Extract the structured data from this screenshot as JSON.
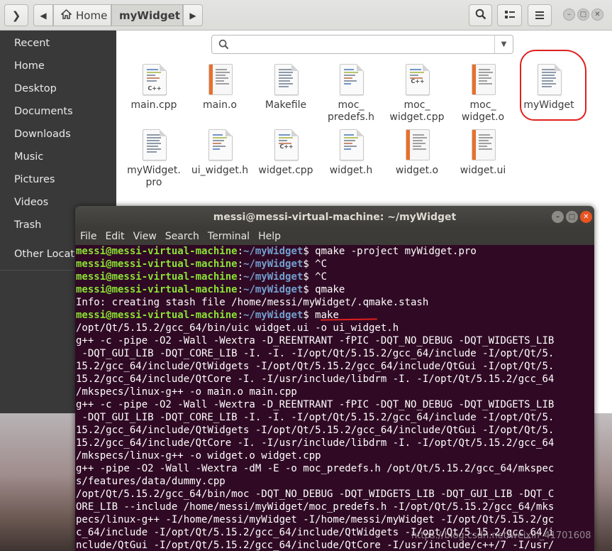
{
  "files_window": {
    "path": {
      "home_label": "Home",
      "current_label": "myWidget"
    },
    "sidebar": [
      {
        "label": "Recent"
      },
      {
        "label": "Home"
      },
      {
        "label": "Desktop"
      },
      {
        "label": "Documents"
      },
      {
        "label": "Downloads"
      },
      {
        "label": "Music"
      },
      {
        "label": "Pictures"
      },
      {
        "label": "Videos"
      },
      {
        "label": "Trash"
      },
      {
        "label": "Other Locations"
      }
    ],
    "search": {
      "placeholder": ""
    },
    "files": [
      {
        "name": "main.cpp",
        "icon": "cpp-file-icon"
      },
      {
        "name": "main.o",
        "icon": "object-file-icon"
      },
      {
        "name": "Makefile",
        "icon": "text-file-icon"
      },
      {
        "name": "moc_ predefs.h",
        "icon": "header-file-icon"
      },
      {
        "name": "moc_ widget.cpp",
        "icon": "cpp-file-icon"
      },
      {
        "name": "moc_ widget.o",
        "icon": "object-file-icon"
      },
      {
        "name": "myWidget",
        "icon": "executable-file-icon"
      },
      {
        "name": "myWidget. pro",
        "icon": "text-file-icon"
      },
      {
        "name": "ui_widget.h",
        "icon": "header-file-icon"
      },
      {
        "name": "widget.cpp",
        "icon": "cpp-file-icon"
      },
      {
        "name": "widget.h",
        "icon": "header-file-icon"
      },
      {
        "name": "widget.o",
        "icon": "object-file-icon"
      },
      {
        "name": "widget.ui",
        "icon": "object-file-icon"
      }
    ],
    "annotation_color": "#e0201e"
  },
  "terminal": {
    "title": "messi@messi-virtual-machine: ~/myWidget",
    "menu": [
      "File",
      "Edit",
      "View",
      "Search",
      "Terminal",
      "Help"
    ],
    "prompt_user": "messi@messi-virtual-machine",
    "prompt_path": "~/myWidget",
    "prompt_lines": [
      {
        "cmd": "$ qmake -project myWidget.pro"
      },
      {
        "cmd": "$ ^C"
      },
      {
        "cmd": "$ ^C"
      },
      {
        "cmd": "$ qmake"
      }
    ],
    "info_line": "Info: creating stash file /home/messi/myWidget/.qmake.stash",
    "make_cmd": "$ make",
    "output_lines": [
      "/opt/Qt/5.15.2/gcc_64/bin/uic widget.ui -o ui_widget.h",
      "g++ -c -pipe -O2 -Wall -Wextra -D_REENTRANT -fPIC -DQT_NO_DEBUG -DQT_WIDGETS_LIB",
      " -DQT_GUI_LIB -DQT_CORE_LIB -I. -I. -I/opt/Qt/5.15.2/gcc_64/include -I/opt/Qt/5.",
      "15.2/gcc_64/include/QtWidgets -I/opt/Qt/5.15.2/gcc_64/include/QtGui -I/opt/Qt/5.",
      "15.2/gcc_64/include/QtCore -I. -I/usr/include/libdrm -I. -I/opt/Qt/5.15.2/gcc_64",
      "/mkspecs/linux-g++ -o main.o main.cpp",
      "g++ -c -pipe -O2 -Wall -Wextra -D_REENTRANT -fPIC -DQT_NO_DEBUG -DQT_WIDGETS_LIB",
      " -DQT_GUI_LIB -DQT_CORE_LIB -I. -I. -I/opt/Qt/5.15.2/gcc_64/include -I/opt/Qt/5.",
      "15.2/gcc_64/include/QtWidgets -I/opt/Qt/5.15.2/gcc_64/include/QtGui -I/opt/Qt/5.",
      "15.2/gcc_64/include/QtCore -I. -I/usr/include/libdrm -I. -I/opt/Qt/5.15.2/gcc_64",
      "/mkspecs/linux-g++ -o widget.o widget.cpp",
      "g++ -pipe -O2 -Wall -Wextra -dM -E -o moc_predefs.h /opt/Qt/5.15.2/gcc_64/mkspec",
      "s/features/data/dummy.cpp",
      "/opt/Qt/5.15.2/gcc_64/bin/moc -DQT_NO_DEBUG -DQT_WIDGETS_LIB -DQT_GUI_LIB -DQT_C",
      "ORE_LIB --include /home/messi/myWidget/moc_predefs.h -I/opt/Qt/5.15.2/gcc_64/mks",
      "pecs/linux-g++ -I/home/messi/myWidget -I/home/messi/myWidget -I/opt/Qt/5.15.2/gc",
      "c_64/include -I/opt/Qt/5.15.2/gcc_64/include/QtWidgets -I/opt/Qt/5.15.2/gcc_64/i",
      "nclude/QtGui -I/opt/Qt/5.15.2/gcc_64/include/QtCore -I/usr/include/c++/7 -I/usr/"
    ],
    "colors": {
      "background": "#300a24",
      "user": "#8ae234",
      "path": "#729fcf"
    }
  },
  "watermark": "https://blog.csdn.net/weixin_41701608"
}
